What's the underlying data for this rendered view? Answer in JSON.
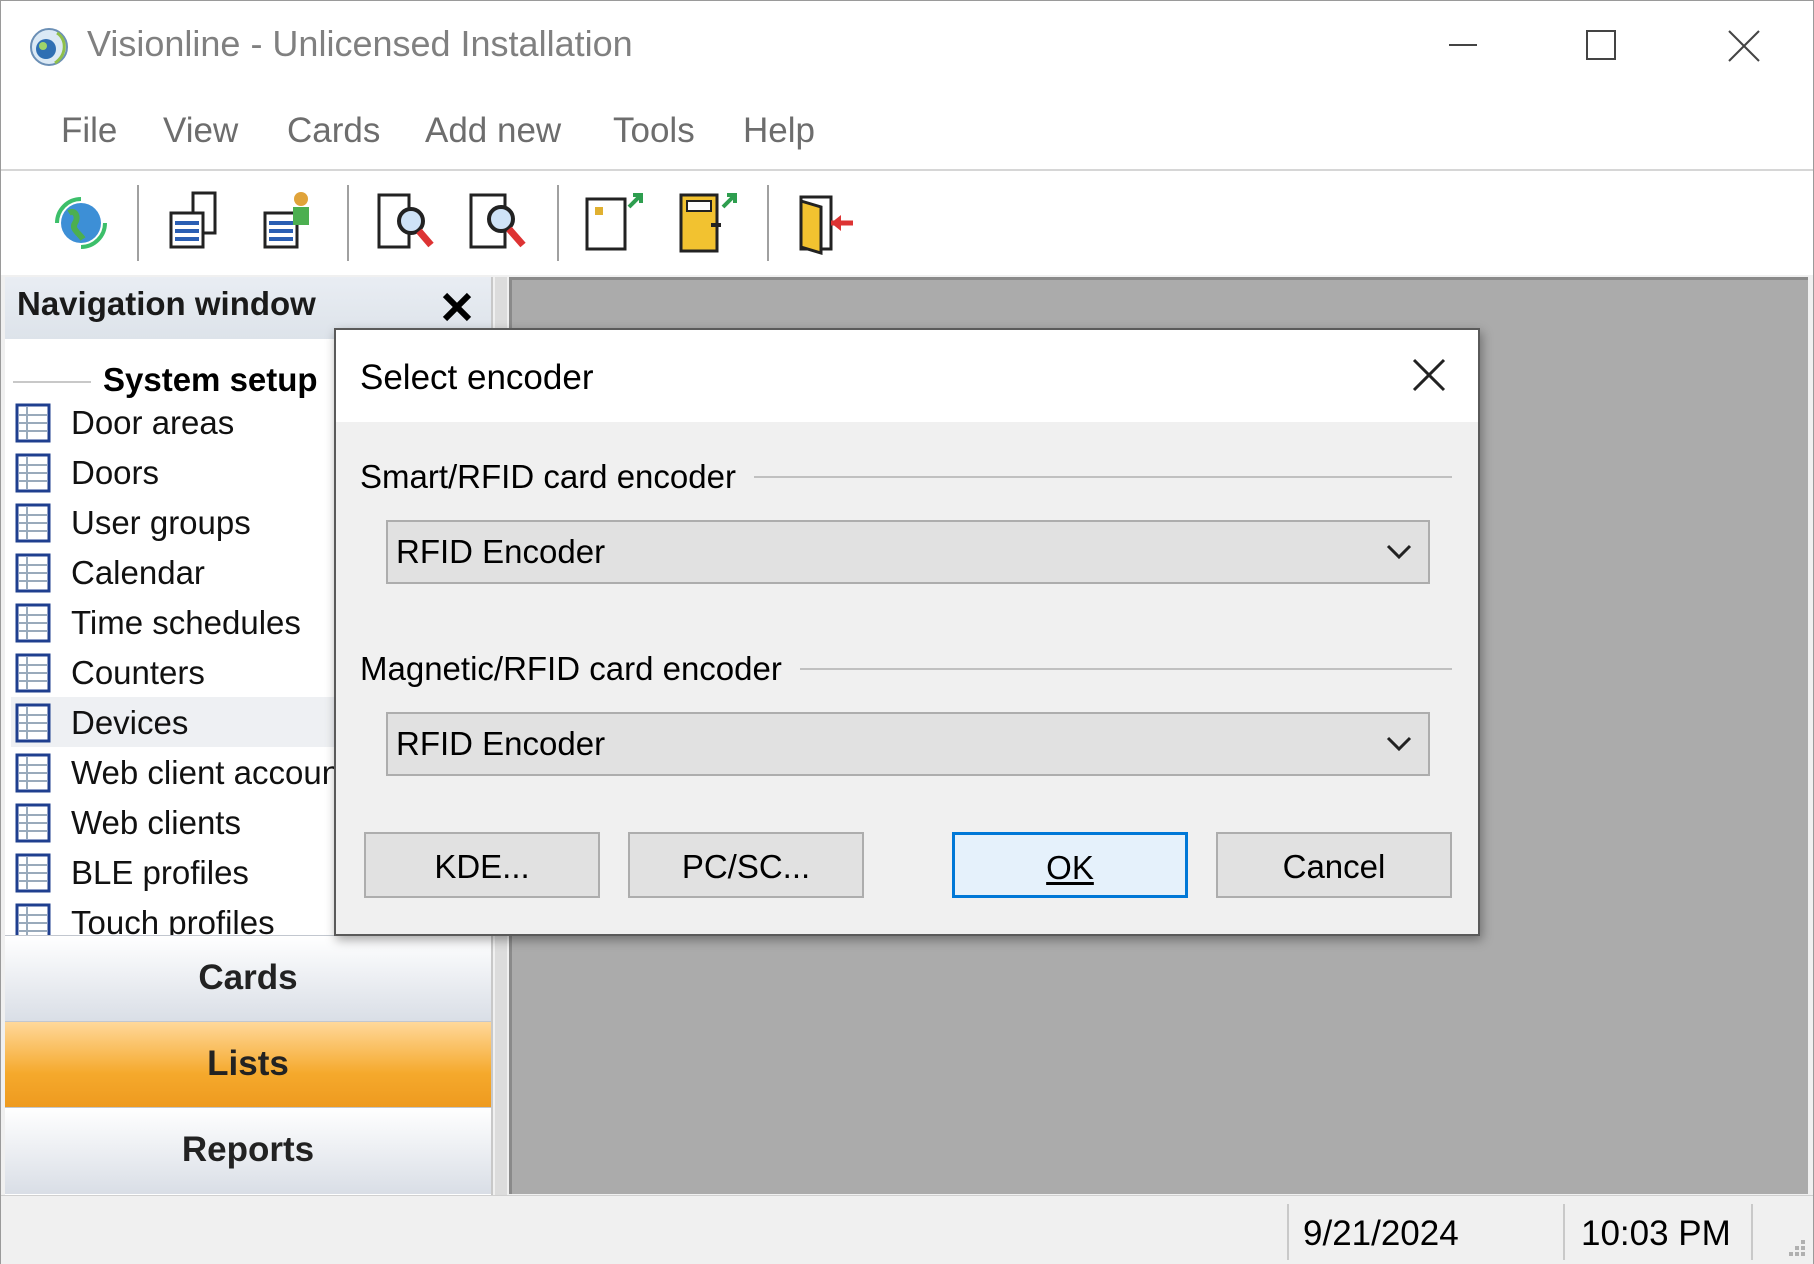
{
  "window": {
    "title": "Visionline - Unlicensed Installation"
  },
  "menu": {
    "items": [
      "File",
      "View",
      "Cards",
      "Add new",
      "Tools",
      "Help"
    ]
  },
  "toolbar": {
    "icons": [
      "globe-icon",
      "list-icon",
      "user-list-icon",
      "card-search-icon",
      "search-icon",
      "card-export-icon",
      "door-export-icon",
      "exit-door-icon"
    ]
  },
  "navigation": {
    "title": "Navigation window",
    "section_title": "System setup",
    "items": [
      {
        "label": "Door areas"
      },
      {
        "label": "Doors"
      },
      {
        "label": "User groups"
      },
      {
        "label": "Calendar"
      },
      {
        "label": "Time schedules"
      },
      {
        "label": "Counters"
      },
      {
        "label": "Devices"
      },
      {
        "label": "Web client accounts"
      },
      {
        "label": "Web clients"
      },
      {
        "label": "BLE profiles"
      },
      {
        "label": "Touch profiles"
      }
    ],
    "selected": "Devices",
    "sections": {
      "cards": "Cards",
      "lists": "Lists",
      "reports": "Reports"
    },
    "active_section": "Lists",
    "active_color": "#f5a92c"
  },
  "statusbar": {
    "date": "9/21/2024",
    "time": "10:03 PM"
  },
  "dialog": {
    "title": "Select encoder",
    "smart_group": {
      "label": "Smart/RFID card encoder",
      "value": "RFID Encoder"
    },
    "magnetic_group": {
      "label": "Magnetic/RFID card encoder",
      "value": "RFID Encoder"
    },
    "buttons": {
      "kde": "KDE...",
      "pcsc": "PC/SC...",
      "ok": "OK",
      "cancel": "Cancel"
    },
    "accent": "#0078d7"
  }
}
